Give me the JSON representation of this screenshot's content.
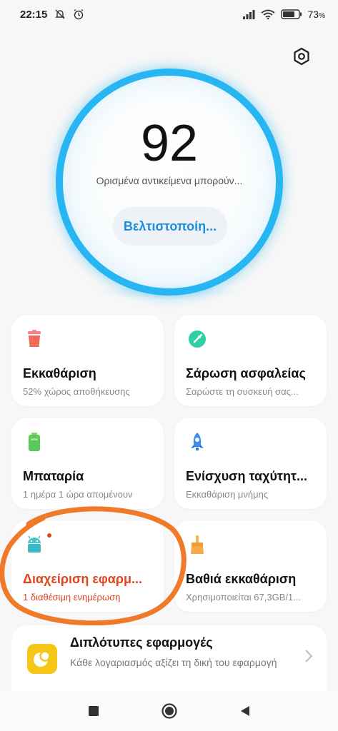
{
  "status_bar": {
    "time": "22:15",
    "battery": "73",
    "battery_unit": "%",
    "icons": [
      "mute-bell-icon",
      "alarm-icon",
      "signal-icon",
      "wifi-icon",
      "battery-icon"
    ]
  },
  "score": {
    "value": "92",
    "description": "Ορισμένα αντικείμενα μπορούν...",
    "optimize_label": "Βελτιστοποίη..."
  },
  "colors": {
    "ring": "#27b6f2",
    "accent_blue": "#1b8fe0",
    "highlight": "#e0451e",
    "annotation": "#f07a2a"
  },
  "cards": {
    "cleanup": {
      "title": "Εκκαθάριση",
      "sub": "52% χώρος αποθήκευσης",
      "icon": "trash-icon"
    },
    "security": {
      "title": "Σάρωση ασφαλείας",
      "sub": "Σαρώστε τη συσκευή σας...",
      "icon": "security-scan-icon"
    },
    "battery": {
      "title": "Μπαταρία",
      "sub": "1 ημέρα 1 ώρα  απομένουν",
      "icon": "battery-card-icon"
    },
    "boost": {
      "title": "Ενίσχυση ταχύτητ...",
      "sub": "Εκκαθάριση μνήμης",
      "icon": "rocket-icon"
    },
    "apps": {
      "title": "Διαχείριση εφαρμ...",
      "sub": "1 διαθέσιμη ενημέρωση",
      "icon": "android-icon"
    },
    "deep_clean": {
      "title": "Βαθιά εκκαθάριση",
      "sub": "Χρησιμοποιείται 67,3GB/1...",
      "icon": "broom-icon"
    }
  },
  "duplicate_apps": {
    "title": "Διπλότυπες εφαρμογές",
    "sub": "Κάθε λογαριασμός αξίζει τη δική του εφαρμογή",
    "icon": "dual-apps-icon"
  }
}
